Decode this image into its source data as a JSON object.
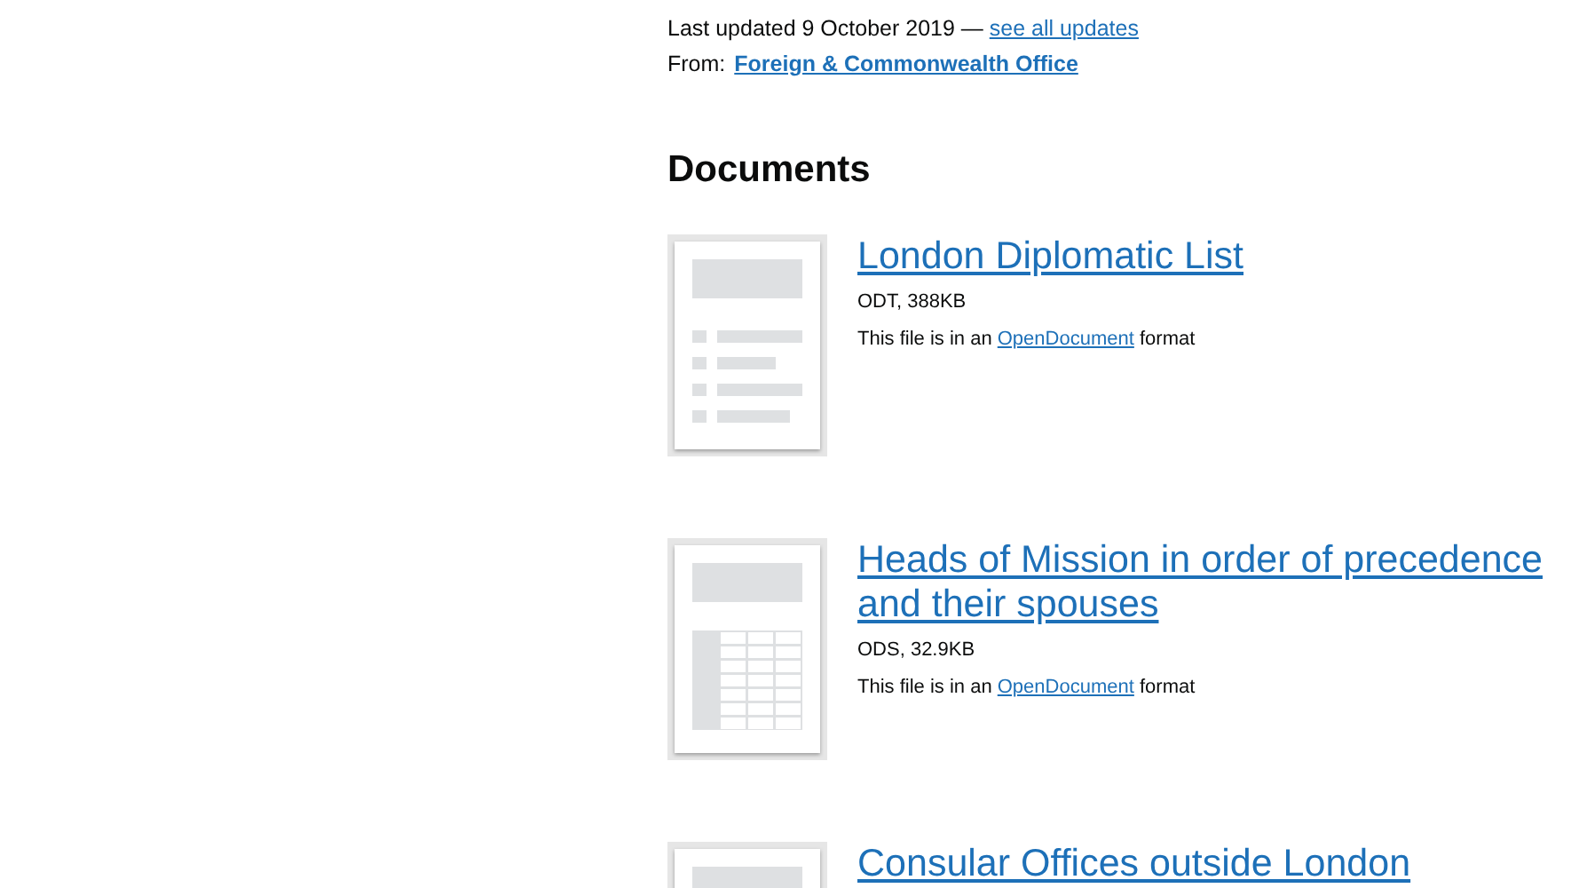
{
  "metadata": {
    "updated_text": "Last updated 9 October 2019 — ",
    "updates_link": "see all updates",
    "from_label": "From:",
    "from_link": "Foreign & Commonwealth Office"
  },
  "documents": {
    "heading": "Documents",
    "attachments": [
      {
        "kind": "document",
        "title": "London Diplomatic List",
        "file_info": "ODT, 388KB",
        "format_prefix": "This file is in an ",
        "format_link": "OpenDocument",
        "format_suffix": " format"
      },
      {
        "kind": "spreadsheet",
        "title": "Heads of Mission in order of precedence and their spouses",
        "file_info": "ODS, 32.9KB",
        "format_prefix": "This file is in an ",
        "format_link": "OpenDocument",
        "format_suffix": " format"
      },
      {
        "kind": "document",
        "title": "Consular Offices outside London"
      }
    ]
  }
}
